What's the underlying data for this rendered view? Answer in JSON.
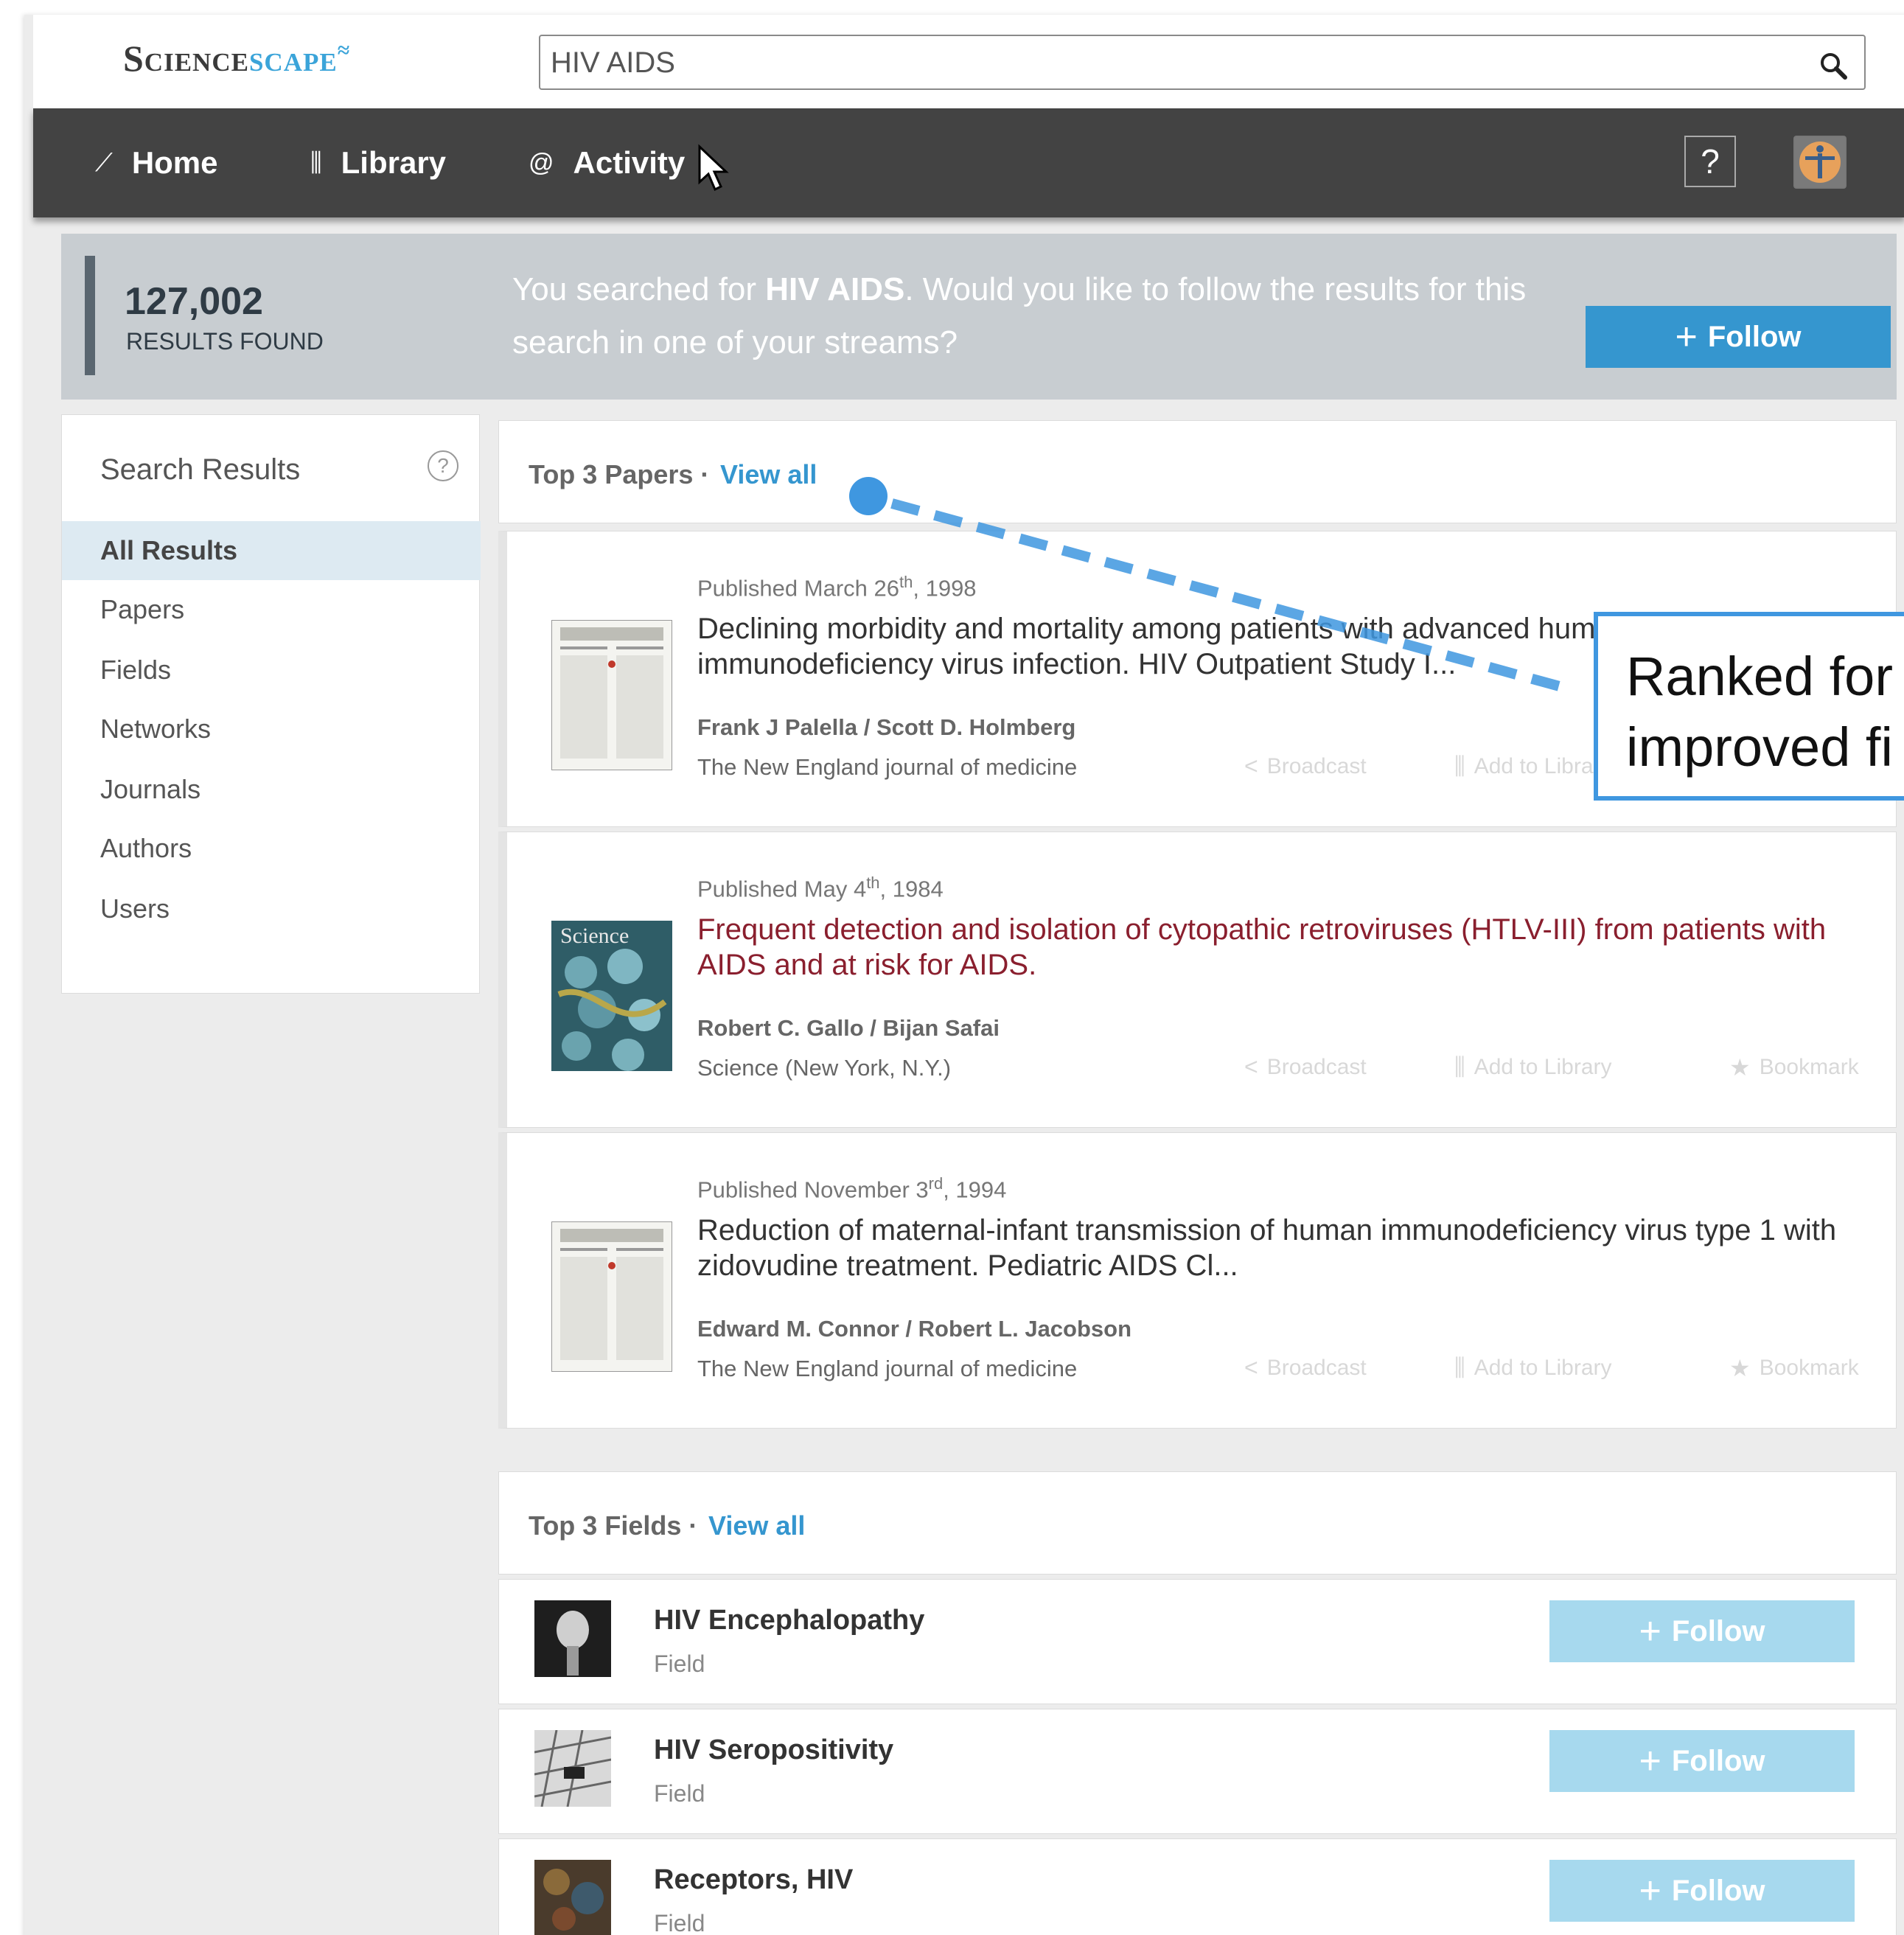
{
  "brand": {
    "logo_part1": "Science",
    "logo_part2": "scape"
  },
  "search": {
    "value": "HIV AIDS",
    "icon": "search-icon"
  },
  "nav": {
    "items": [
      {
        "label": "Home",
        "icon": "home-icon"
      },
      {
        "label": "Library",
        "icon": "library-icon"
      },
      {
        "label": "Activity",
        "icon": "at-icon"
      }
    ],
    "help_label": "?"
  },
  "results": {
    "count": "127,002",
    "count_label": "RESULTS FOUND",
    "message_pre": "You searched for ",
    "query": "HIV AIDS",
    "message_post": ". Would you like to follow the results for this search in one of your streams?",
    "follow_label": "Follow"
  },
  "sidebar": {
    "title": "Search Results",
    "help_label": "?",
    "items": [
      {
        "label": "All Results",
        "active": true
      },
      {
        "label": "Papers"
      },
      {
        "label": "Fields"
      },
      {
        "label": "Networks"
      },
      {
        "label": "Journals"
      },
      {
        "label": "Authors"
      },
      {
        "label": "Users"
      }
    ]
  },
  "papers_section": {
    "title": "Top 3 Papers ·",
    "view_all": "View all"
  },
  "papers": [
    {
      "date_pre": "Published March 26",
      "date_sup": "th",
      "date_post": ", 1998",
      "title": "Declining morbidity and mortality among patients with advanced human immunodeficiency virus infection. HIV Outpatient Study I...",
      "authors": "Frank J Palella / Scott D. Holmberg",
      "journal": "The New England journal of medicine"
    },
    {
      "date_pre": "Published May 4",
      "date_sup": "th",
      "date_post": ", 1984",
      "title": "Frequent detection and isolation of cytopathic retroviruses (HTLV-III) from patients with AIDS and at risk for AIDS.",
      "authors": "Robert C. Gallo / Bijan Safai",
      "journal": "Science (New York, N.Y.)",
      "thumb_label": "Science"
    },
    {
      "date_pre": "Published November 3",
      "date_sup": "rd",
      "date_post": ", 1994",
      "title": "Reduction of maternal-infant transmission of human immunodeficiency virus type 1 with zidovudine treatment. Pediatric AIDS Cl...",
      "authors": "Edward M. Connor / Robert L. Jacobson",
      "journal": "The New England journal of medicine"
    }
  ],
  "actions": {
    "broadcast": "Broadcast",
    "add_to_library": "Add to Library",
    "bookmark": "Bookmark"
  },
  "fields_section": {
    "title": "Top 3 Fields ·",
    "view_all": "View all"
  },
  "fields": [
    {
      "name": "HIV Encephalopathy",
      "type": "Field",
      "follow": "Follow"
    },
    {
      "name": "HIV Seropositivity",
      "type": "Field",
      "follow": "Follow"
    },
    {
      "name": "Receptors, HIV",
      "type": "Field",
      "follow": "Follow"
    }
  ],
  "annotation": {
    "text": "Ranked for\nimproved fi"
  },
  "colors": {
    "accent": "#3596cf",
    "navbar": "#434343",
    "banner": "#c8cdd1",
    "annotation": "#3f97e0",
    "visited_title": "#8a1f2e"
  }
}
